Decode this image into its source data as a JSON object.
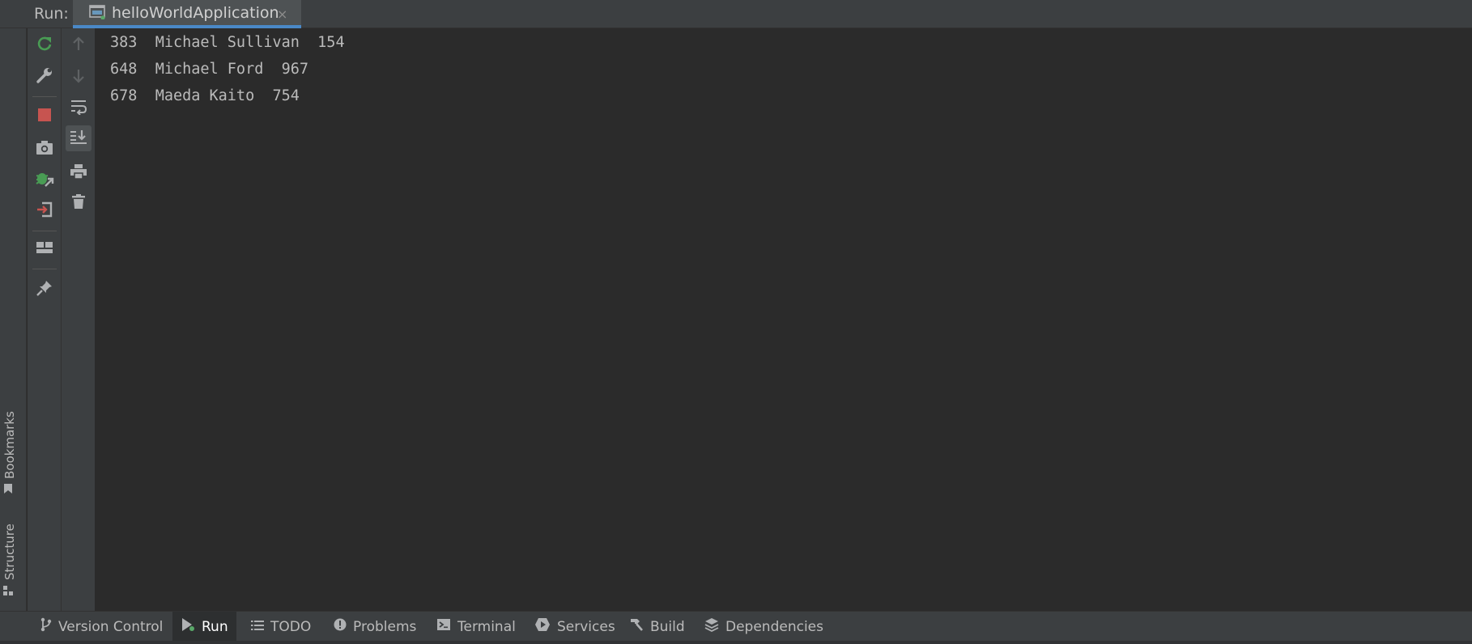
{
  "header": {
    "run_label": "Run:",
    "tab": {
      "title": "helloWorldApplication",
      "close": "×",
      "icon": "run-config-icon"
    }
  },
  "left_strip": {
    "bookmarks": "Bookmarks",
    "structure": "Structure"
  },
  "toolbar1": [
    {
      "name": "rerun-icon",
      "color": "#499c54"
    },
    {
      "name": "wrench-icon",
      "color": "#afb1b3"
    },
    {
      "name": "stop-icon",
      "color": "#c75450"
    },
    {
      "name": "camera-icon",
      "color": "#afb1b3"
    },
    {
      "name": "debug-attach-icon",
      "color": "#499c54"
    },
    {
      "name": "exit-icon",
      "color": "#afb1b3"
    },
    {
      "name": "layout-icon",
      "color": "#afb1b3"
    },
    {
      "name": "pin-icon",
      "color": "#afb1b3"
    }
  ],
  "toolbar2": [
    {
      "name": "up-arrow-icon"
    },
    {
      "name": "down-arrow-icon"
    },
    {
      "name": "soft-wrap-icon"
    },
    {
      "name": "scroll-to-end-icon",
      "active": true
    },
    {
      "name": "print-icon"
    },
    {
      "name": "trash-icon"
    }
  ],
  "console": {
    "lines": [
      "383  Michael Sullivan  154",
      "648  Michael Ford  967",
      "678  Maeda Kaito  754"
    ]
  },
  "bottom_bar": {
    "tabs": [
      {
        "label": "Version Control",
        "icon": "branch-icon"
      },
      {
        "label": "Run",
        "icon": "play-icon",
        "active": true
      },
      {
        "label": "TODO",
        "icon": "list-icon"
      },
      {
        "label": "Problems",
        "icon": "warning-icon"
      },
      {
        "label": "Terminal",
        "icon": "terminal-icon"
      },
      {
        "label": "Services",
        "icon": "services-icon"
      },
      {
        "label": "Build",
        "icon": "hammer-icon"
      },
      {
        "label": "Dependencies",
        "icon": "layers-icon"
      }
    ]
  }
}
